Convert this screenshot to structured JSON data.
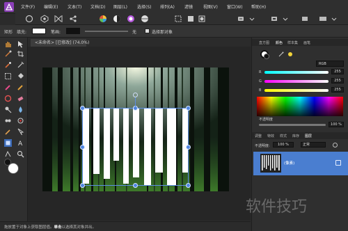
{
  "menubar": {
    "items": [
      "文件(F)",
      "编辑(E)",
      "文本(T)",
      "文档(D)",
      "图层(L)",
      "选择(S)",
      "排列(A)",
      "滤镜",
      "视图(V)",
      "窗口(W)",
      "帮助(H)"
    ]
  },
  "context_toolbar": {
    "shape_label": "矩形",
    "fill_label": "填充:",
    "stroke_label": "笔画:",
    "stroke_value": "无",
    "select_label": "选择那对象"
  },
  "document": {
    "tab_title": "<未命名> [已修改] (74.0%)"
  },
  "right_panel": {
    "top_tabs": [
      "直方图",
      "颜色",
      "样本集",
      "画笔"
    ],
    "active_top_tab": "颜色",
    "color_mode": "RGB",
    "channels": [
      {
        "label": "R",
        "value": "255"
      },
      {
        "label": "G",
        "value": "255"
      },
      {
        "label": "B",
        "value": "255"
      }
    ],
    "opacity_label": "不透明度",
    "opacity_value": "100 %",
    "layer_tabs": [
      "调整",
      "特效",
      "样式",
      "库存",
      "图层"
    ],
    "active_layer_tab": "图层",
    "layer_opacity_label": "不透明度:",
    "layer_opacity_value": "100 %",
    "blend_mode": "正常",
    "layer_name": "(像素)"
  },
  "status": {
    "text_before": "拖放置于对象上获取图层值。",
    "bold_word": "单击",
    "text_after": "以选择其对象并出。"
  },
  "watermark": "软件技巧",
  "colors": {
    "accent_blue": "#4a7ed0",
    "app_purple": "#8b3fb8"
  }
}
